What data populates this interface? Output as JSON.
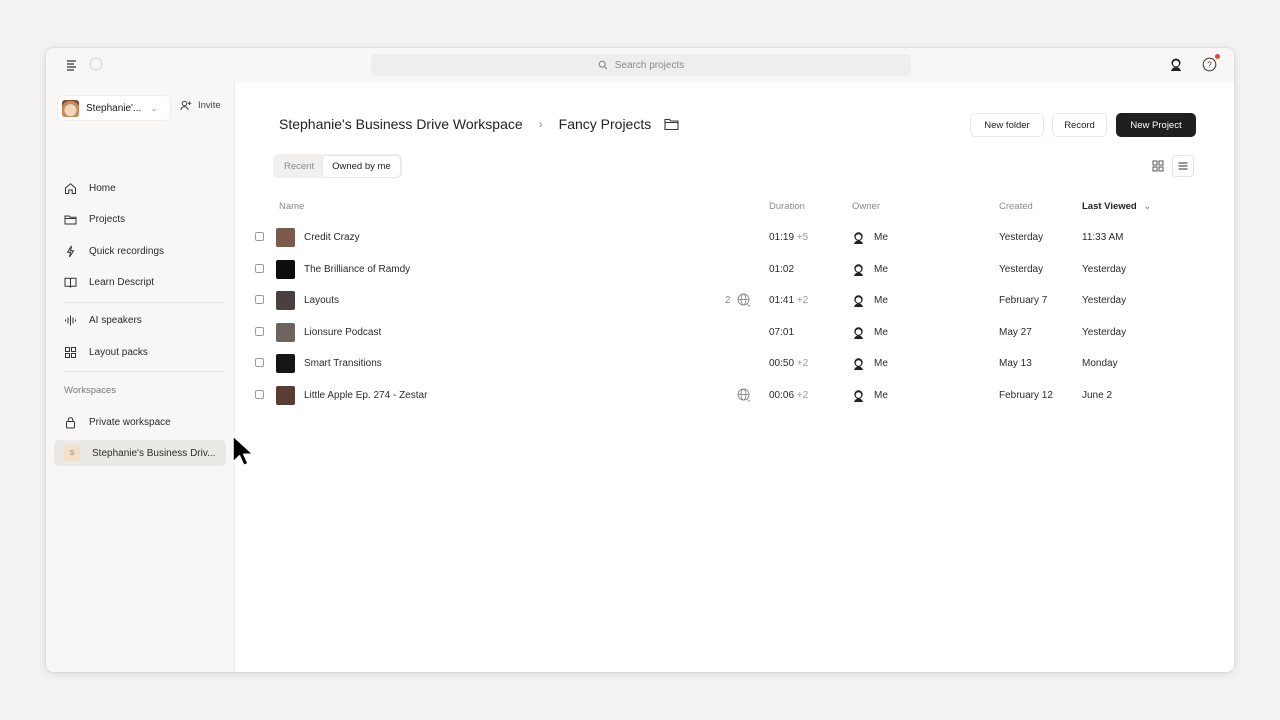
{
  "search": {
    "placeholder": "Search projects"
  },
  "sidebar": {
    "workspace_name": "Stephanie'...",
    "invite_label": "Invite",
    "items": [
      {
        "label": "Home",
        "icon": "home-icon"
      },
      {
        "label": "Projects",
        "icon": "folder-icon"
      },
      {
        "label": "Quick recordings",
        "icon": "bolt-icon"
      },
      {
        "label": "Learn Descript",
        "icon": "book-icon"
      },
      {
        "label": "AI speakers",
        "icon": "waveform-icon"
      },
      {
        "label": "Layout packs",
        "icon": "grid-icon"
      }
    ],
    "workspaces_title": "Workspaces",
    "workspaces": [
      {
        "label": "Private workspace",
        "icon": "lock-icon"
      },
      {
        "label": "Stephanie's Business Driv...",
        "badge": "S",
        "active": true
      }
    ]
  },
  "header": {
    "breadcrumb_root": "Stephanie's Business Drive Workspace",
    "breadcrumb_current": "Fancy Projects",
    "new_folder": "New folder",
    "record": "Record",
    "new_project": "New Project"
  },
  "tabs": {
    "recent": "Recent",
    "owned": "Owned by me"
  },
  "table": {
    "columns": {
      "name": "Name",
      "duration": "Duration",
      "owner": "Owner",
      "created": "Created",
      "last_viewed": "Last Viewed"
    },
    "rows": [
      {
        "name": "Credit Crazy",
        "duration": "01:19",
        "extra": "+5",
        "owner": "Me",
        "created": "Yesterday",
        "last_viewed": "11:33 AM",
        "shares": "",
        "thumb": "#7a5a4a"
      },
      {
        "name": "The Brilliance of Ramdy",
        "duration": "01:02",
        "extra": "",
        "owner": "Me",
        "created": "Yesterday",
        "last_viewed": "Yesterday",
        "shares": "",
        "thumb": "#0d0d0d"
      },
      {
        "name": "Layouts",
        "duration": "01:41",
        "extra": "+2",
        "owner": "Me",
        "created": "February 7",
        "last_viewed": "Yesterday",
        "shares": "2",
        "thumb": "#4a4040"
      },
      {
        "name": "Lionsure Podcast",
        "duration": "07:01",
        "extra": "",
        "owner": "Me",
        "created": "May 27",
        "last_viewed": "Yesterday",
        "shares": "",
        "thumb": "#6d6460"
      },
      {
        "name": "Smart Transitions",
        "duration": "00:50",
        "extra": "+2",
        "owner": "Me",
        "created": "May 13",
        "last_viewed": "Monday",
        "shares": "",
        "thumb": "#151515"
      },
      {
        "name": "Little Apple Ep. 274 - Zestar",
        "duration": "00:06",
        "extra": "+2",
        "owner": "Me",
        "created": "February 12",
        "last_viewed": "June 2",
        "shares": "",
        "thumb": "#5a3d32"
      }
    ]
  }
}
